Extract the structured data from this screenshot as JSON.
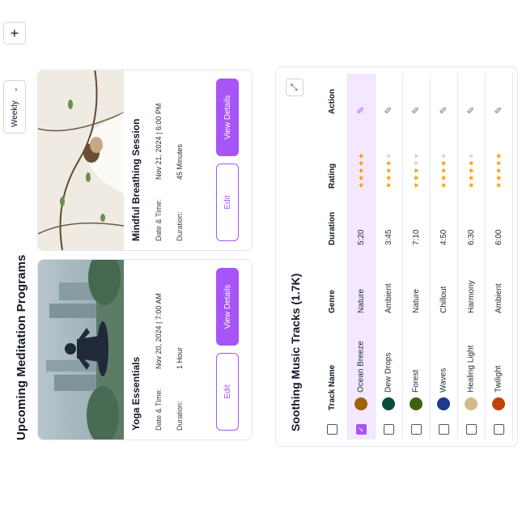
{
  "programs": {
    "title": "Upcoming Meditation Programs",
    "filter": "Weekly",
    "add_label": "+",
    "cards": [
      {
        "title": "Yoga Essentials",
        "date_label": "Date & Time:",
        "date": "Nov 20, 2024 | 7:00 AM",
        "duration_label": "Duration:",
        "duration": "1 Hour",
        "edit_label": "Edit",
        "view_label": "View Details"
      },
      {
        "title": "Mindful Breathing Session",
        "date_label": "Date & Time:",
        "date": "Nov 21, 2024 | 6:00 PM",
        "duration_label": "Duration:",
        "duration": "45 Minutes",
        "edit_label": "Edit",
        "view_label": "View Details"
      }
    ]
  },
  "tracks": {
    "title": "Soothing Music Tracks (1.7K)",
    "columns": [
      "Track Name",
      "Genre",
      "Duration",
      "Rating",
      "Action"
    ],
    "rows": [
      {
        "name": "Twilight",
        "genre": "Ambient",
        "duration": "6:00",
        "rating": 5,
        "selected": false,
        "avatar_color": "#c2410c"
      },
      {
        "name": "Healing Light",
        "genre": "Harmony",
        "duration": "6:30",
        "rating": 4,
        "selected": false,
        "avatar_color": "#d6b98a"
      },
      {
        "name": "Waves",
        "genre": "Chillout",
        "duration": "4:50",
        "rating": 4,
        "selected": false,
        "avatar_color": "#1e3a8a"
      },
      {
        "name": "Forest",
        "genre": "Nature",
        "duration": "7:10",
        "rating": 3,
        "selected": false,
        "avatar_color": "#3f6212"
      },
      {
        "name": "Dew Drops",
        "genre": "Ambient",
        "duration": "3:45",
        "rating": 4,
        "selected": false,
        "avatar_color": "#064e3b"
      },
      {
        "name": "Ocean Breeze",
        "genre": "Nature",
        "duration": "5:20",
        "rating": 5,
        "selected": true,
        "avatar_color": "#a16207"
      }
    ]
  },
  "colors": {
    "accent": "#a855f7",
    "star": "#f59e0b",
    "star_empty": "#d1d5db"
  }
}
